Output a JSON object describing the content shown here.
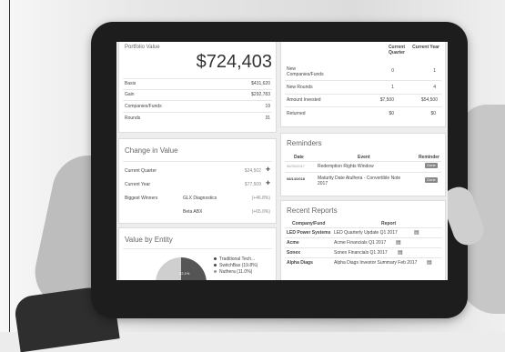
{
  "portfolio": {
    "title": "Portfolio Value",
    "value": "$724,403",
    "rows": [
      {
        "label": "Basis",
        "value": "$431,620"
      },
      {
        "label": "Gain",
        "value": "$292,783"
      },
      {
        "label": "Companies/Funds",
        "value": "19"
      },
      {
        "label": "Rounds",
        "value": "31"
      }
    ]
  },
  "summary": {
    "headers": [
      "Current Quarter",
      "Current Year"
    ],
    "rows": [
      {
        "label": "New Companies/Funds",
        "q": "0",
        "y": "1"
      },
      {
        "label": "New Rounds",
        "q": "1",
        "y": "4"
      },
      {
        "label": "Amount Invested",
        "q": "$7,500",
        "y": "$54,500"
      },
      {
        "label": "Returned",
        "q": "$0",
        "y": "$0"
      }
    ]
  },
  "change": {
    "title": "Change in Value",
    "rows": [
      {
        "label": "Current Quarter",
        "value": "$24,502"
      },
      {
        "label": "Current Year",
        "value": "$77,509"
      }
    ],
    "winners_label": "Biggest Winners",
    "winners": [
      {
        "name": "GLX Diagnostics",
        "value": "(+46.8%)"
      },
      {
        "name": "Beta ABX",
        "value": "(+65.0%)"
      }
    ]
  },
  "reminders": {
    "title": "Reminders",
    "headers": [
      "Date",
      "Event",
      "Reminder"
    ],
    "rows": [
      {
        "date": "06/30/2017",
        "event": "Redemption Rights Window",
        "button": "Done"
      },
      {
        "date": "08/14/2018",
        "event": "Maturity Date Atulhera - Convertible Note 2017",
        "button": "Done"
      }
    ]
  },
  "entity": {
    "title": "Value by Entity",
    "slice_label": "22.1%",
    "legend": [
      "Traditional Tech...",
      "SwitchBas (19.8%)",
      "Nuthera (11.0%)"
    ]
  },
  "reports": {
    "title": "Recent Reports",
    "headers": [
      "Company/Fund",
      "Report"
    ],
    "rows": [
      {
        "company": "LED Power Systems",
        "report": "LED Quarterly Update Q1 2017"
      },
      {
        "company": "Acme",
        "report": "Acme Financials Q1 2017"
      },
      {
        "company": "Sonex",
        "report": "Sonex Financials Q1 2017"
      },
      {
        "company": "Alpha Diags",
        "report": "Alpha Diags Investor Summary Feb 2017"
      }
    ]
  }
}
